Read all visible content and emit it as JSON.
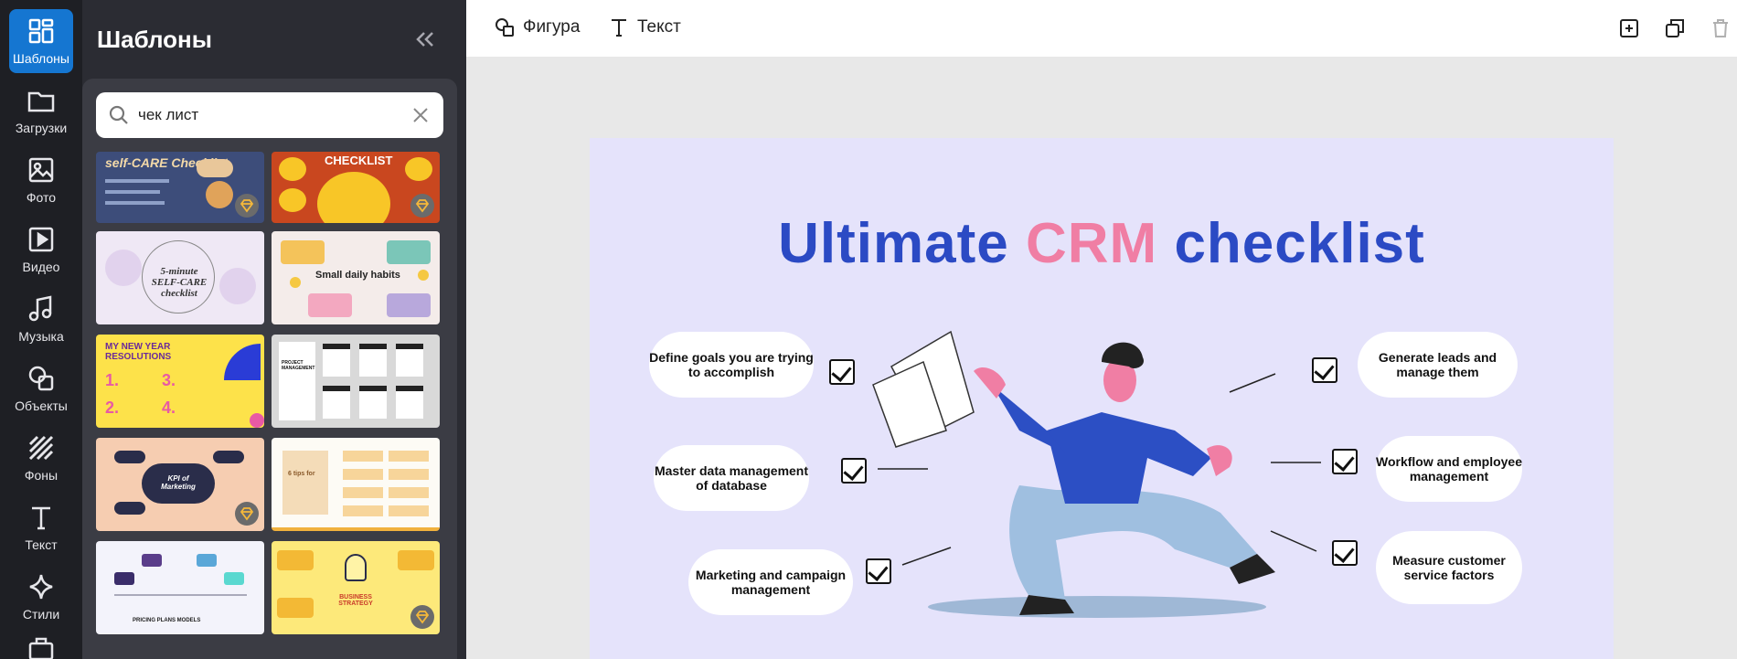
{
  "rail": {
    "items": [
      {
        "label": "Шаблоны",
        "icon": "templates-icon"
      },
      {
        "label": "Загрузки",
        "icon": "folder-icon"
      },
      {
        "label": "Фото",
        "icon": "image-icon"
      },
      {
        "label": "Видео",
        "icon": "video-icon"
      },
      {
        "label": "Музыка",
        "icon": "music-icon"
      },
      {
        "label": "Объекты",
        "icon": "shapes-icon"
      },
      {
        "label": "Фоны",
        "icon": "backgrounds-icon"
      },
      {
        "label": "Текст",
        "icon": "text-icon"
      },
      {
        "label": "Стили",
        "icon": "sparkle-icon"
      }
    ],
    "active_color": "#1576d1"
  },
  "panel": {
    "title": "Шаблоны",
    "search": {
      "value": "чек лист"
    },
    "thumbs": [
      {
        "name": "self-care-checklist",
        "text": "self-CARE Checklist",
        "premium": true
      },
      {
        "name": "travel-checklist",
        "text": "CHECKLIST",
        "premium": true
      },
      {
        "name": "5-minute-self-care",
        "text": "5-minute SELF-CARE checklist",
        "premium": false
      },
      {
        "name": "small-daily-habits",
        "text": "Small daily habits",
        "premium": false
      },
      {
        "name": "new-year-resolutions",
        "text": "MY NEW YEAR RESOLUTIONS",
        "premium": false
      },
      {
        "name": "project-management",
        "text": "PROJECT MANAGEMENT",
        "premium": false
      },
      {
        "name": "kpi-marketing",
        "text": "KPI of Marketing",
        "premium": true
      },
      {
        "name": "tips-for-checklist",
        "text": "6 tips for",
        "premium": false
      },
      {
        "name": "pricing-plans-models",
        "text": "PRICING PLANS MODELS",
        "premium": false
      },
      {
        "name": "business-strategy",
        "text": "BUSINESS STRATEGY",
        "premium": true
      }
    ]
  },
  "toolbar": {
    "shape_label": "Фигура",
    "text_label": "Текст"
  },
  "slide": {
    "title_part1": "Ultimate",
    "title_part2": "CRM",
    "title_part3": "checklist",
    "items_left": [
      "Define goals you are trying to accomplish",
      "Master data management of database",
      "Marketing and campaign management"
    ],
    "items_right": [
      "Generate leads and manage them",
      "Workflow and employee management",
      "Measure customer service factors"
    ],
    "colors": {
      "blue": "#2b4ac4",
      "pink": "#f07ea4",
      "background": "#e5e3fb"
    }
  }
}
